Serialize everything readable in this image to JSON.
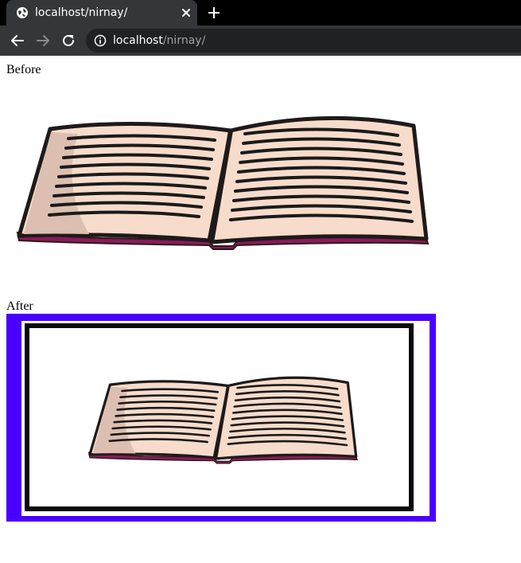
{
  "browser": {
    "tab_title": "localhost/nirnay/",
    "url_host": "localhost",
    "url_path": "/nirnay/",
    "icons": {
      "favicon": "globe-icon",
      "close": "close-icon",
      "new_tab": "plus-icon",
      "back": "arrow-left-icon",
      "forward": "arrow-right-icon",
      "reload": "reload-icon",
      "site_info": "info-icon"
    }
  },
  "page": {
    "before_label": "Before",
    "after_label": "After",
    "after_frame_color": "#4a00ff"
  }
}
